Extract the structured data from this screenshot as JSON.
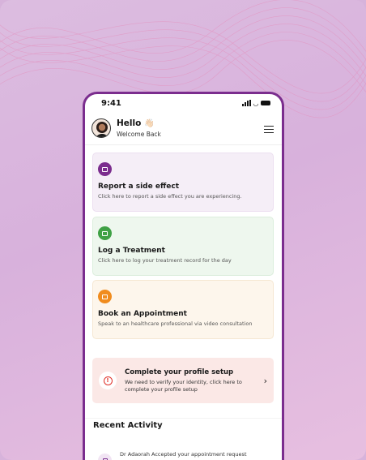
{
  "status_bar": {
    "time": "9:41"
  },
  "header": {
    "greeting": "Hello",
    "wave_emoji": "👋🏻",
    "subtitle": "Welcome Back"
  },
  "cards": [
    {
      "title": "Report a side effect",
      "description": "Click here to report a side effect you are experiencing.",
      "accent": "#7b2d8e"
    },
    {
      "title": "Log a Treatment",
      "description": "Click here to log your treatment record for the day",
      "accent": "#3fa145"
    },
    {
      "title": "Book an Appointment",
      "description": "Speak to an healthcare professional via video consultation",
      "accent": "#f08c1e"
    }
  ],
  "profile_setup": {
    "title": "Complete your profile setup",
    "description": "We need to verify your identity, click here to complete your profile setup",
    "icon": "!"
  },
  "recent_activity": {
    "title": "Recent Activity",
    "items": [
      {
        "text": "Dr Adaorah Accepted your appointment request"
      }
    ]
  }
}
